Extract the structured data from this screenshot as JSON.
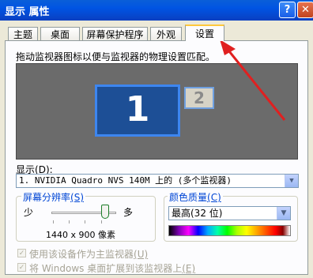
{
  "window": {
    "title": "显示 属性",
    "help_button": "?",
    "close_button": "✕"
  },
  "tabs": [
    {
      "label": "主题",
      "active": false
    },
    {
      "label": "桌面",
      "active": false
    },
    {
      "label": "屏幕保护程序",
      "active": false
    },
    {
      "label": "外观",
      "active": false
    },
    {
      "label": "设置",
      "active": true
    }
  ],
  "settings": {
    "instruction": "拖动监视器图标以便与监视器的物理设置匹配。",
    "monitors": [
      {
        "number": "1",
        "selected": true
      },
      {
        "number": "2",
        "selected": false
      }
    ],
    "display_label": "显示",
    "display_accel": "(D):",
    "display_value": "1. NVIDIA Quadro NVS 140M 上的 (多个监视器)",
    "resolution": {
      "group_label": "屏幕分辨率",
      "group_accel": "(S)",
      "less_label": "少",
      "more_label": "多",
      "value": "1440 x 900 像素"
    },
    "color_quality": {
      "group_label": "颜色质量",
      "group_accel": "(C)",
      "selected": "最高(32 位)"
    },
    "checkboxes": [
      {
        "label": "使用该设备作为主监视器",
        "accel": "(U)",
        "checked": true,
        "enabled": false
      },
      {
        "label": "将 Windows 桌面扩展到该监视器上",
        "accel": "(E)",
        "checked": true,
        "enabled": false
      }
    ]
  },
  "colors": {
    "title_bar": "#0054e3",
    "annotation_arrow": "#e02020",
    "group_label": "#0046d5"
  }
}
